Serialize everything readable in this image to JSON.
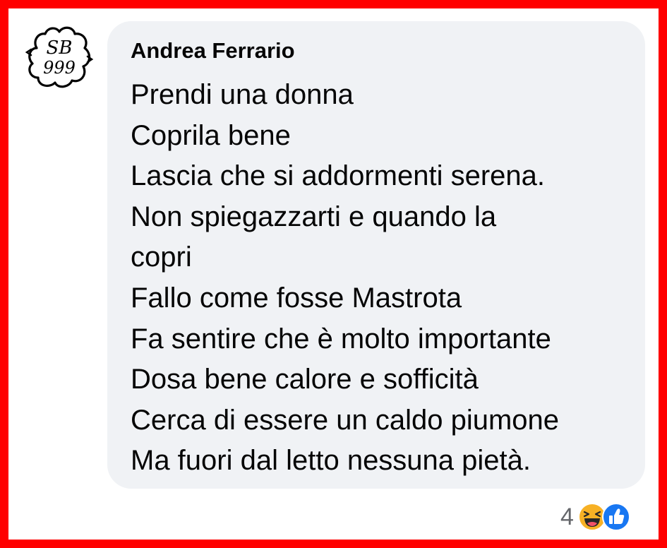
{
  "comment": {
    "avatar": {
      "icon": "cloud-badge-icon",
      "line1": "SB",
      "line2": "999"
    },
    "author": "Andrea Ferrario",
    "lines": [
      "Prendi una donna",
      "Coprila bene",
      "Lascia che si addormenti serena.",
      "Non spiegazzarti e quando la",
      "copri",
      "Fallo come fosse Mastrota",
      "Fa sentire che è molto importante",
      "Dosa bene calore e sofficità",
      "Cerca di essere un caldo piumone",
      "Ma fuori dal letto nessuna pietà."
    ],
    "reactions": {
      "count": "4",
      "icons": [
        "laughing-emoji-icon",
        "thumbs-up-icon"
      ]
    }
  },
  "colors": {
    "border": "#ff0000",
    "bubble": "#f0f2f5",
    "text": "#050505",
    "count": "#65676b",
    "like": "#1877f2",
    "haha": "#f7b125"
  }
}
